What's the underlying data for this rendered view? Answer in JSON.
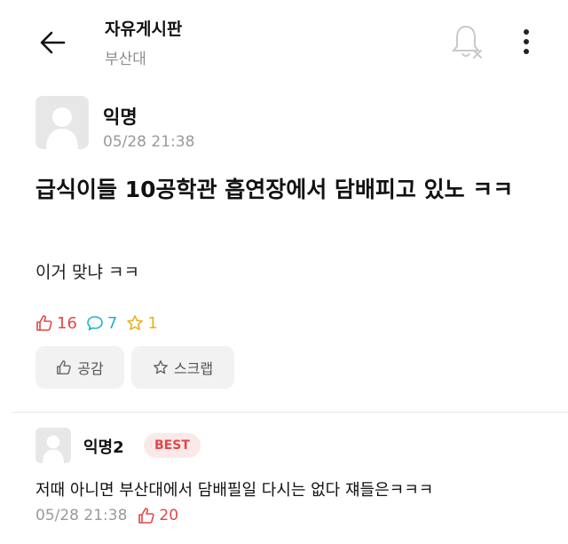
{
  "header": {
    "board_title": "자유게시판",
    "board_subtitle": "부산대",
    "icons": [
      "back-arrow-icon",
      "bell-off-icon",
      "more-vertical-icon"
    ]
  },
  "post": {
    "author": "익명",
    "time": "05/28 21:38",
    "title": "급식이들 10공학관 흡연장에서 담배피고 있노 ㅋㅋ",
    "body": "이거 맞냐 ㅋㅋ",
    "stats": {
      "likes": "16",
      "comments": "7",
      "scraps": "1"
    }
  },
  "actions": {
    "like_label": "공감",
    "scrap_label": "스크랩"
  },
  "comment": {
    "author": "익명2",
    "badge": "BEST",
    "text": "저때 아니면 부산대에서 담배필일 다시는 없다 쟤들은ㅋㅋㅋ",
    "time": "05/28 21:38",
    "likes": "20"
  },
  "colors": {
    "accent_red": "#e14848",
    "comment_cyan": "#1fb3c9",
    "scrap_yellow": "#e9b21c",
    "muted_gray": "#9a9a9a",
    "button_bg": "#f2f2f2",
    "avatar_bg": "#e7e7e7"
  }
}
